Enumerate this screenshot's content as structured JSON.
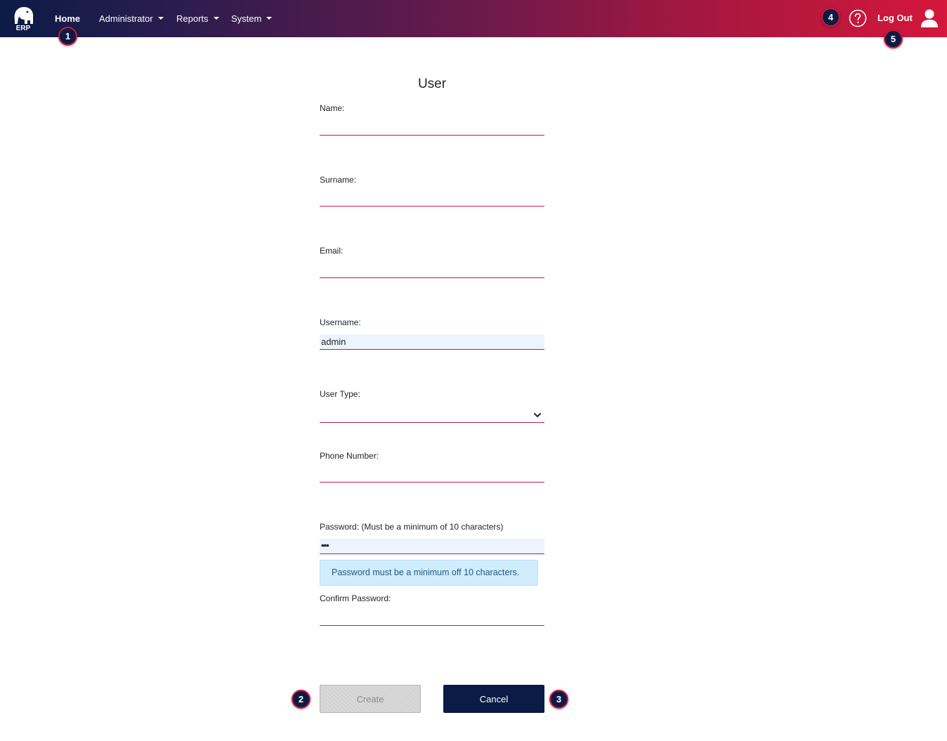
{
  "navbar": {
    "logo_text": "ERP",
    "menu": [
      {
        "label": "Home",
        "has_dropdown": false,
        "active": true
      },
      {
        "label": "Administrator",
        "has_dropdown": true
      },
      {
        "label": "Reports",
        "has_dropdown": true
      },
      {
        "label": "System",
        "has_dropdown": true
      }
    ],
    "help_icon": "question-circle-icon",
    "logout_label": "Log Out",
    "user_icon": "user-icon"
  },
  "form": {
    "title": "User",
    "name_label": "Name:",
    "name_value": "",
    "surname_label": "Surname:",
    "surname_value": "",
    "email_label": "Email:",
    "email_value": "",
    "username_label": "Username:",
    "username_value": "admin",
    "user_type_label": "User Type:",
    "user_type_value": "",
    "phone_label": "Phone Number:",
    "phone_value": "",
    "password_label": "Password: (Must be a minimum of 10 characters)",
    "password_value": "•••",
    "password_error": "Password must be a minimum off 10 characters.",
    "confirm_password_label": "Confirm Password:",
    "confirm_password_value": ""
  },
  "buttons": {
    "create_label": "Create",
    "create_disabled": true,
    "cancel_label": "Cancel"
  },
  "markers": [
    "1",
    "2",
    "3",
    "4",
    "5"
  ],
  "colors": {
    "navbar_start": "#0b1b45",
    "navbar_end": "#d4173b",
    "input_underline": "#c2185b",
    "alert_bg": "#d1ecfb",
    "primary_button": "#0b1b45"
  }
}
